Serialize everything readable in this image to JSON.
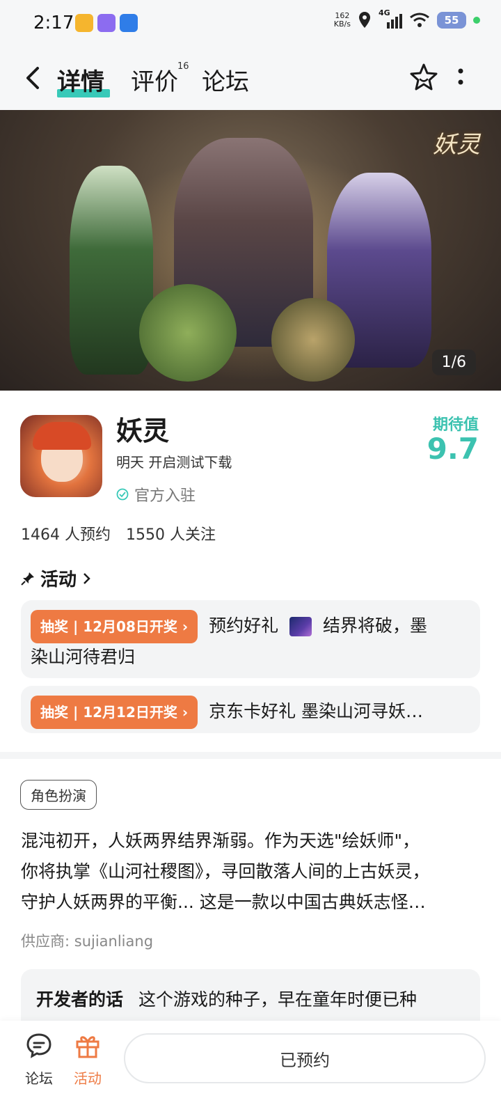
{
  "status_bar": {
    "time": "2:17",
    "speed_value": "162",
    "speed_unit": "KB/s",
    "network": "4G",
    "battery": "55"
  },
  "nav": {
    "tabs": [
      {
        "label": "详情",
        "active": true
      },
      {
        "label": "评价",
        "active": false
      },
      {
        "label": "论坛",
        "active": false
      }
    ],
    "review_count": "16"
  },
  "banner": {
    "logo_text": "妖灵",
    "counter": "1/6"
  },
  "game": {
    "title": "妖灵",
    "subtitle": "明天 开启测试下载",
    "official": "官方入驻",
    "expect_label": "期待值",
    "expect_value": "9.7"
  },
  "stats": {
    "reservations": "1464 人预约",
    "followers": "1550 人关注"
  },
  "activity": {
    "title": "活动",
    "items": [
      {
        "pill": "抽奖 | 12月08日开奖 ›",
        "text_a": "预约好礼",
        "text_b": "结界将破，墨",
        "text_c": "染山河待君归"
      },
      {
        "pill": "抽奖 | 12月12日开奖 ›",
        "text_a": "京东卡好礼 墨染山河寻妖…"
      }
    ]
  },
  "details": {
    "tag": "角色扮演",
    "description": [
      "混沌初开，人妖两界结界渐弱。作为天选\"绘妖师\"，",
      "你将执掌《山河社稷图》，寻回散落人间的上古妖灵，",
      "守护人妖两界的平衡... 这是一款以中国古典妖志怪…"
    ],
    "supplier": "供应商: sujianliang",
    "dev_label": "开发者的话",
    "dev_text": "这个游戏的种子，早在童年时便已种"
  },
  "bottom_bar": {
    "forum_label": "论坛",
    "activity_label": "活动",
    "reserved_label": "已预约"
  },
  "colors": {
    "accent": "#38c9b8",
    "orange": "#ee7a43"
  }
}
